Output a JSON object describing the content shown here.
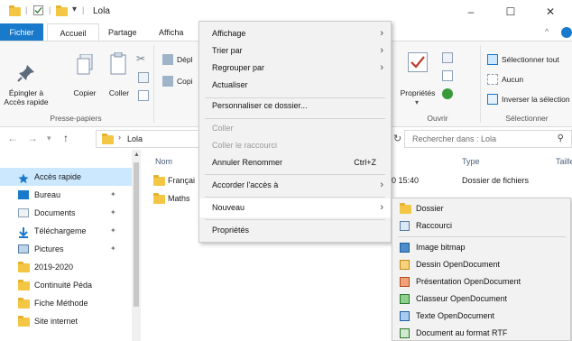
{
  "window": {
    "title": "Lola",
    "qa_separator": "|",
    "qa_dropdown": "▾",
    "minimize": "–",
    "maximize": "☐",
    "close": "✕"
  },
  "ribbon_tabs": [
    "Fichier",
    "Accueil",
    "Partage",
    "Afficha"
  ],
  "ribbon": {
    "pin_label_1": "Épingler à",
    "pin_label_2": "Accès rapide",
    "copy_label": "Copier",
    "paste_label": "Coller",
    "clipboard_group": "Presse-papiers",
    "move_label": "Dépl",
    "copy_to_label": "Copi",
    "properties_label": "Propriétés",
    "open_group": "Ouvrir",
    "select_all": "Sélectionner tout",
    "select_none": "Aucun",
    "invert_selection": "Inverser la sélection",
    "select_group": "Sélectionner",
    "collapse_icon": "^"
  },
  "navbar": {
    "back": "←",
    "forward": "→",
    "up": "↑",
    "breadcrumb_sep": "›",
    "breadcrumb": "Lola",
    "refresh": "↻",
    "search_placeholder": "Rechercher dans : Lola",
    "search_icon": "⚲"
  },
  "nav_pane": {
    "items": [
      {
        "label": "Accès rapide",
        "icon": "star-icon",
        "pinned": false
      },
      {
        "label": "Bureau",
        "icon": "desktop-icon",
        "pinned": true
      },
      {
        "label": "Documents",
        "icon": "documents-icon",
        "pinned": true
      },
      {
        "label": "Téléchargeme",
        "icon": "download-icon",
        "pinned": true
      },
      {
        "label": "Pictures",
        "icon": "pictures-icon",
        "pinned": true
      },
      {
        "label": "2019-2020",
        "icon": "folder-icon",
        "pinned": false
      },
      {
        "label": "Continuité Péda",
        "icon": "folder-icon",
        "pinned": false
      },
      {
        "label": "Fiche Méthode",
        "icon": "folder-icon",
        "pinned": false
      },
      {
        "label": "Site internet",
        "icon": "folder-icon",
        "pinned": false
      }
    ],
    "pin_glyph": "✦"
  },
  "file_list": {
    "columns": {
      "name": "Nom",
      "type": "Type",
      "size": "Taille"
    },
    "rows": [
      {
        "name": "Françai",
        "date_fragment": "0 15:40",
        "type": "Dossier de fichiers"
      },
      {
        "name": "Maths"
      }
    ]
  },
  "context_menu": {
    "items": [
      {
        "label": "Affichage",
        "submenu": true
      },
      {
        "label": "Trier par",
        "submenu": true
      },
      {
        "label": "Regrouper par",
        "submenu": true
      },
      {
        "label": "Actualiser"
      },
      {
        "label": "Personnaliser ce dossier..."
      },
      {
        "label": "Coller",
        "disabled": true
      },
      {
        "label": "Coller le raccourci",
        "disabled": true
      },
      {
        "label": "Annuler Renommer",
        "shortcut": "Ctrl+Z"
      },
      {
        "label": "Accorder l'accès à",
        "submenu": true
      },
      {
        "label": "Nouveau",
        "submenu": true,
        "highlighted": true
      },
      {
        "label": "Propriétés"
      }
    ],
    "arrow_glyph": "›"
  },
  "new_submenu": {
    "items": [
      {
        "label": "Dossier",
        "icon": "folder-icon"
      },
      {
        "label": "Raccourci",
        "icon": "shortcut-icon"
      },
      {
        "label": "Image bitmap",
        "icon": "bitmap-icon"
      },
      {
        "label": "Dessin OpenDocument",
        "icon": "odg-icon"
      },
      {
        "label": "Présentation OpenDocument",
        "icon": "odp-icon"
      },
      {
        "label": "Classeur OpenDocument",
        "icon": "ods-icon"
      },
      {
        "label": "Texte OpenDocument",
        "icon": "odt-icon"
      },
      {
        "label": "Document au format RTF",
        "icon": "rtf-icon"
      }
    ]
  },
  "colors": {
    "accent": "#1979ca",
    "folder": "#f3c744",
    "selected": "#cce8ff",
    "menu_bg": "#f2f2f2"
  }
}
